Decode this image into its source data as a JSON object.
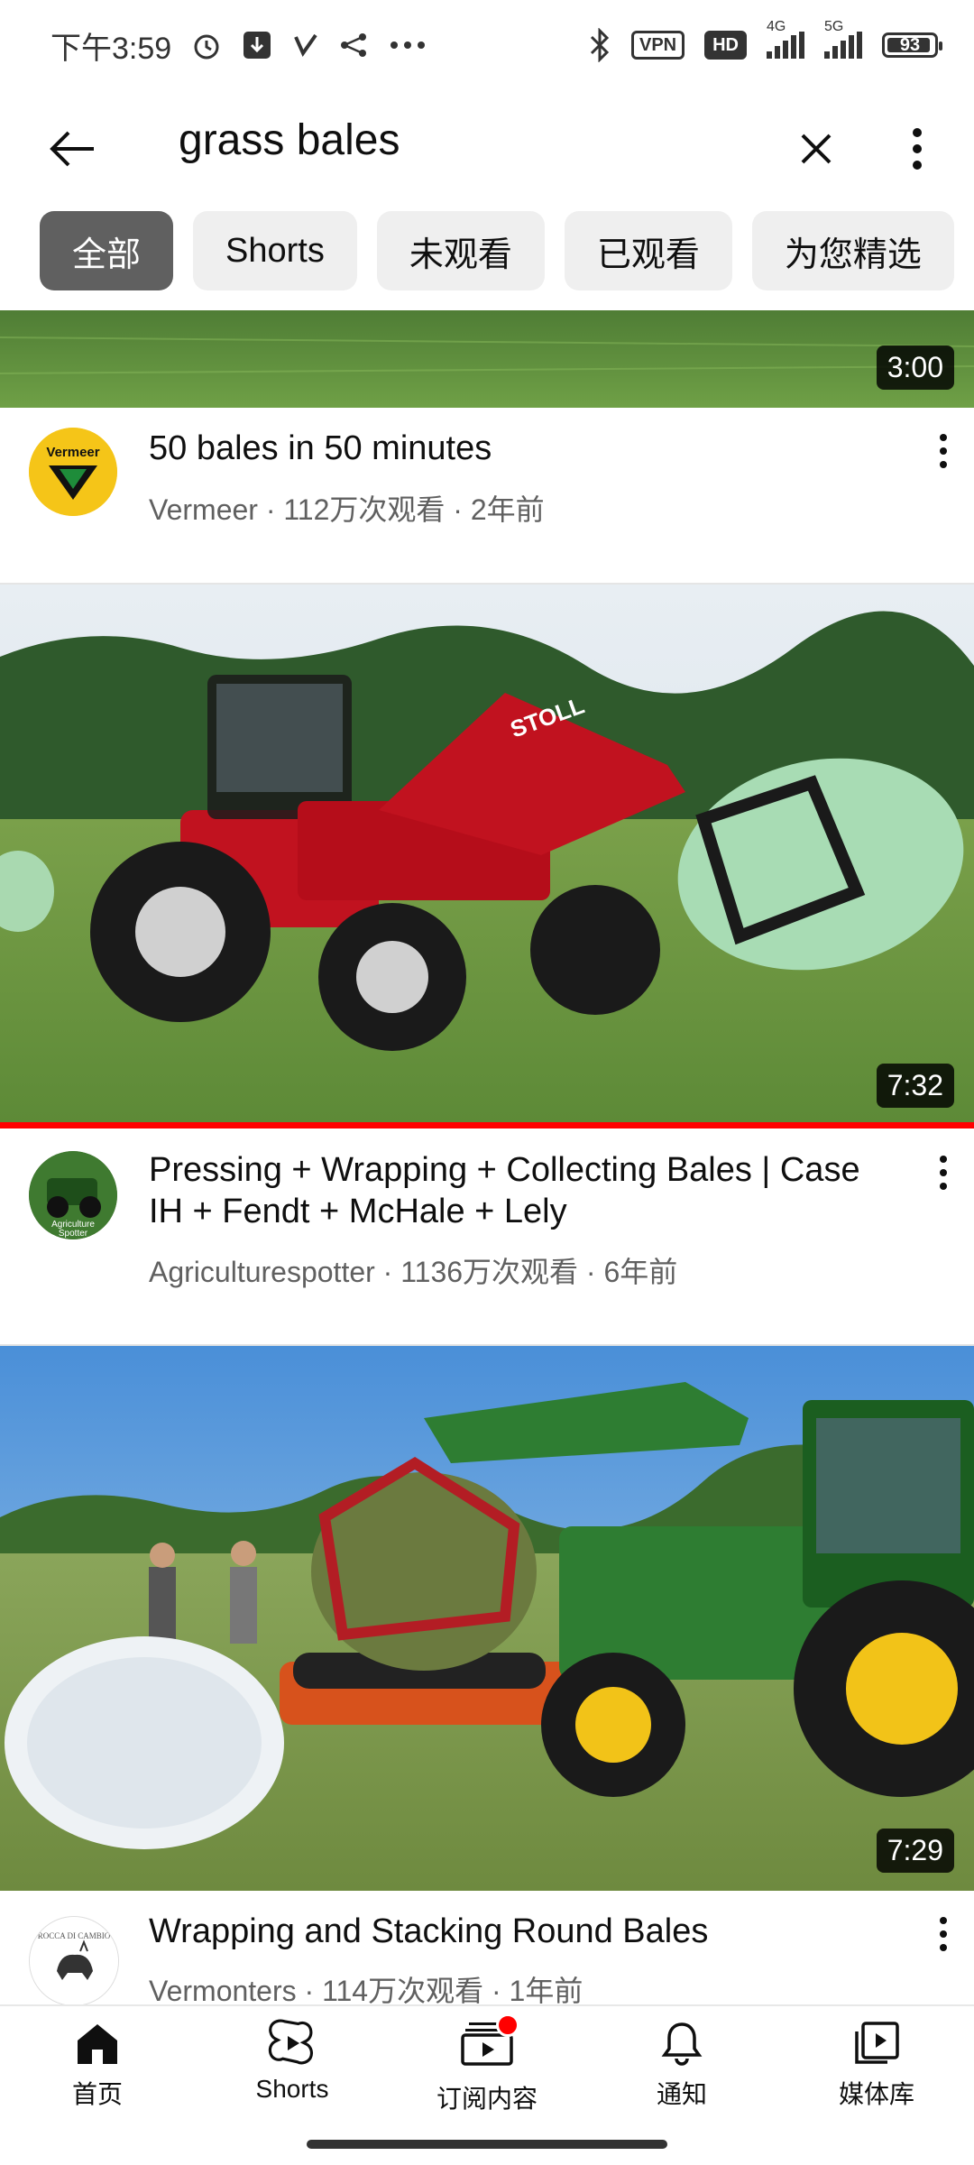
{
  "status_bar": {
    "time": "下午3:59",
    "network_4g": "4G",
    "network_5g": "5G",
    "vpn": "VPN",
    "hd": "HD",
    "battery": "93",
    "battery_level": 0.93
  },
  "search": {
    "query": "grass bales"
  },
  "chips": [
    "全部",
    "Shorts",
    "未观看",
    "已观看",
    "为您精选"
  ],
  "videos": [
    {
      "duration": "3:00",
      "title": "50 bales in 50 minutes",
      "meta": "Vermeer · 112万次观看 · 2年前",
      "avatar_text": "Vermeer"
    },
    {
      "duration": "7:32",
      "title": "Pressing + Wrapping + Collecting Bales | Case IH + Fendt + McHale + Lely",
      "meta": "Agriculturespotter · 1136万次观看 · 6年前",
      "avatar_text": "Agriculture Spotter",
      "thumb_text": "STOLL",
      "progress": 1.0
    },
    {
      "duration": "7:29",
      "title": "Wrapping and Stacking Round Bales",
      "meta": "Vermonters · 114万次观看 · 1年前",
      "avatar_text": "ROCCA DI CAMBIO"
    }
  ],
  "bottom_nav": [
    {
      "label": "首页",
      "icon": "home-icon"
    },
    {
      "label": "Shorts",
      "icon": "shorts-icon"
    },
    {
      "label": "订阅内容",
      "icon": "subscriptions-icon"
    },
    {
      "label": "通知",
      "icon": "bell-icon"
    },
    {
      "label": "媒体库",
      "icon": "library-icon"
    }
  ],
  "colors": {
    "accent_red": "#ff0000",
    "chip_active": "#606060",
    "chip_bg": "#efefef",
    "meta_gray": "#606060"
  }
}
